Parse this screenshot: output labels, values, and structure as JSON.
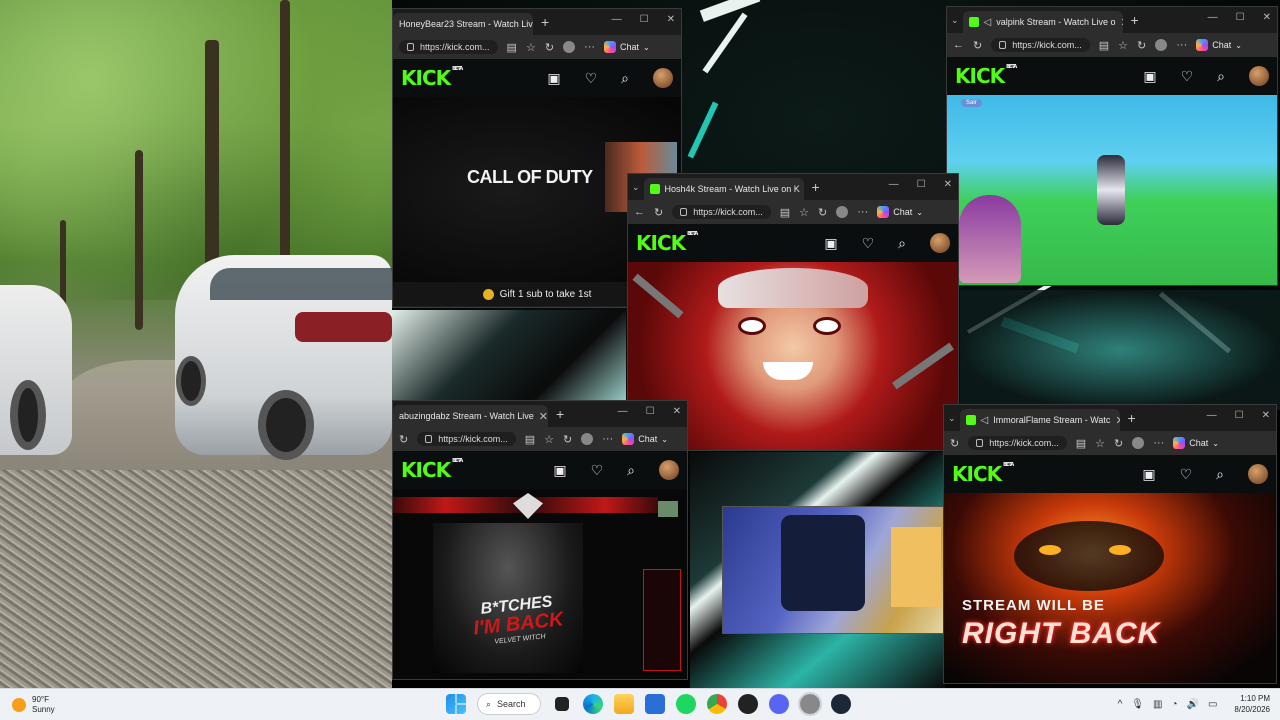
{
  "browser": {
    "url": "https://kick.com...",
    "chat_label": "Chat"
  },
  "kick": {
    "logo": "KICK",
    "beta": "BETA"
  },
  "windows": {
    "honeybear": {
      "tab_title": "HoneyBear23 Stream - Watch Live",
      "game_title": "CALL OF DUTY",
      "gift_banner": "Gift 1 sub to take 1st"
    },
    "valpink": {
      "tab_title": "valpink Stream - Watch Live o",
      "back_chip": "Sair"
    },
    "hosh4k": {
      "tab_title": "Hosh4k Stream - Watch Live on K"
    },
    "abuzing": {
      "tab_title": "abuzingdabz Stream - Watch Live",
      "art_line1": "B*TCHES",
      "art_line2": "I'M BACK",
      "art_line3": "VELVET WITCH"
    },
    "immoral": {
      "tab_title": "ImmoralFlame Stream - Watc",
      "brb_line1": "STREAM WILL BE",
      "brb_line2": "RIGHT BACK"
    }
  },
  "taskbar": {
    "temp": "90°F",
    "condition": "Sunny",
    "search_label": "Search",
    "time": "1:10 PM",
    "date": "8/20/2026"
  },
  "colors": {
    "kick_green": "#53fc18",
    "taskbar_bg": "#eef1f6"
  }
}
